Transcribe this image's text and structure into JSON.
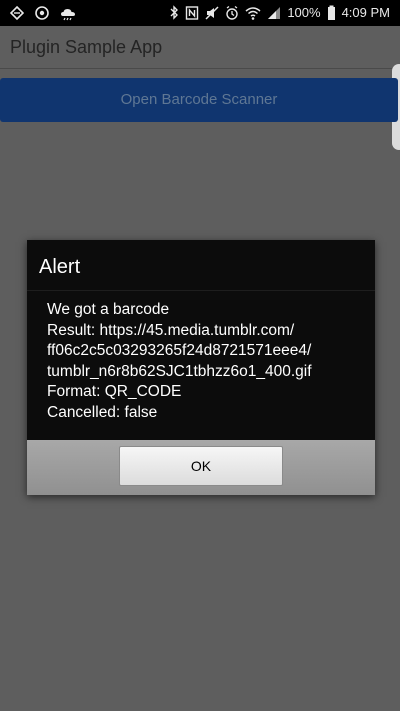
{
  "status_bar": {
    "battery": "100%",
    "time": "4:09 PM",
    "left_icons": [
      "diamond-notification-icon",
      "sync-circle-icon",
      "cloud-icon"
    ],
    "right_icons": [
      "bluetooth-icon",
      "nfc-icon",
      "mute-icon",
      "alarm-icon",
      "wifi-icon",
      "signal-icon",
      "battery-icon"
    ]
  },
  "app": {
    "title": "Plugin Sample App",
    "open_scanner_label": "Open Barcode Scanner"
  },
  "dialog": {
    "title": "Alert",
    "lines": [
      "We got a barcode",
      "Result: https://45.media.tumblr.com/",
      "ff06c2c5c03293265f24d8721571eee4/",
      "tumblr_n6r8b62SJC1tbhzz6o1_400.gif",
      "Format: QR_CODE",
      "Cancelled: false"
    ],
    "ok_label": "OK"
  }
}
